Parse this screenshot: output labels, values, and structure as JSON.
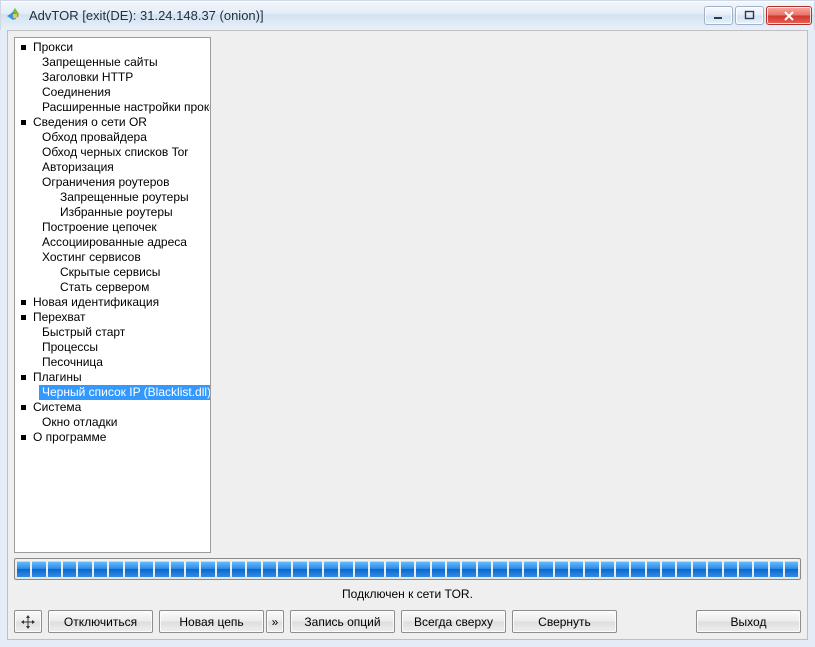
{
  "window": {
    "title": "AdvTOR [exit(DE): 31.24.148.37 (onion)]"
  },
  "tree": {
    "n0": "Прокси",
    "n0a": "Запрещенные сайты",
    "n0b": "Заголовки HTTP",
    "n0c": "Соединения",
    "n0d": "Расширенные настройки прокси",
    "n1": "Сведения о сети OR",
    "n1a": "Обход провайдера",
    "n1b": "Обход черных списков Tor",
    "n1c": "Авторизация",
    "n1d": "Ограничения роутеров",
    "n1d1": "Запрещенные роутеры",
    "n1d2": "Избранные роутеры",
    "n1e": "Построение цепочек",
    "n1f": "Ассоциированные адреса",
    "n1g": "Хостинг сервисов",
    "n1g1": "Скрытые сервисы",
    "n1g2": "Стать сервером",
    "n2": "Новая идентификация",
    "n3": "Перехват",
    "n3a": "Быстрый старт",
    "n3b": "Процессы",
    "n3c": "Песочница",
    "n4": "Плагины",
    "n4a": "Черный список IP (Blacklist.dll)",
    "n5": "Система",
    "n5a": "Окно отладки",
    "n6": "О программе"
  },
  "status": "Подключен к сети TOR.",
  "buttons": {
    "disconnect": "Отключиться",
    "newchain": "Новая цепь",
    "chevright": "»",
    "saveopts": "Запись опций",
    "ontop": "Всегда сверху",
    "minimize": "Свернуть",
    "exit": "Выход"
  },
  "progress": {
    "segments": 51
  }
}
